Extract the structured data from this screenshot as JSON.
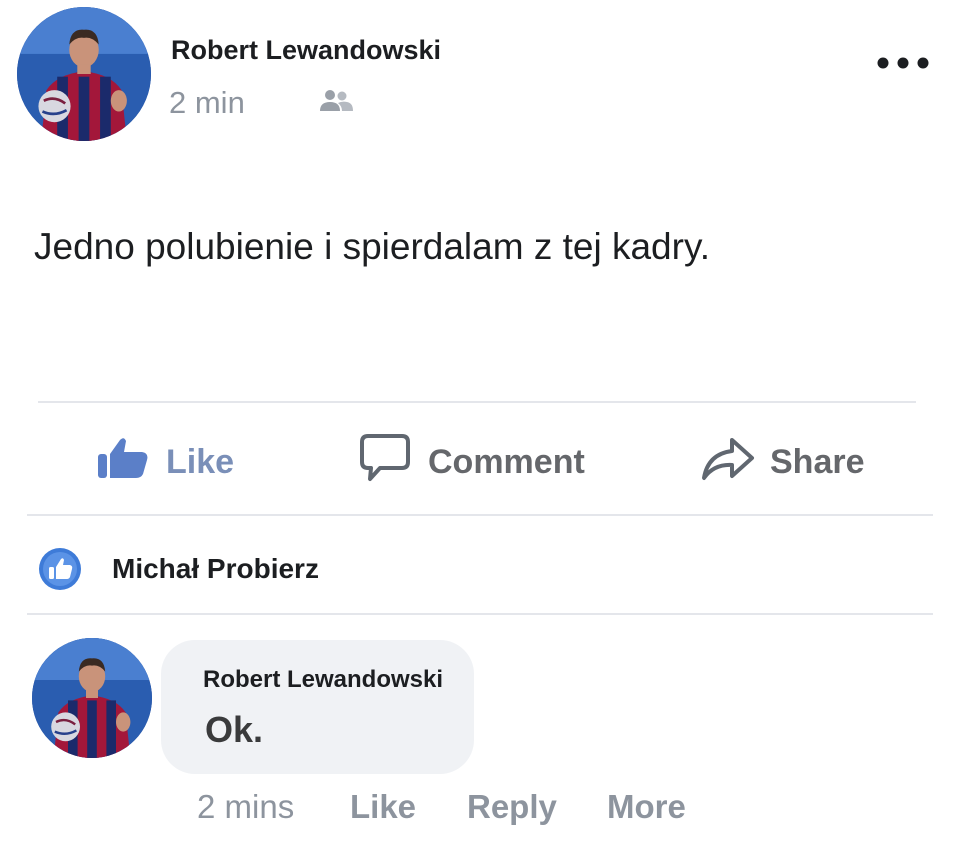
{
  "post": {
    "author": "Robert Lewandowski",
    "time": "2 min",
    "audience_icon": "friends-icon",
    "menu_icon": "more-dots-icon",
    "text": "Jedno polubienie i spierdalam z tej kadry."
  },
  "actions": {
    "like_label": "Like",
    "comment_label": "Comment",
    "share_label": "Share"
  },
  "reactions": {
    "icon": "like-badge-icon",
    "name": "Michał Probierz"
  },
  "comment": {
    "author": "Robert Lewandowski",
    "text": "Ok.",
    "time": "2 mins",
    "like_label": "Like",
    "reply_label": "Reply",
    "more_label": "More"
  },
  "colors": {
    "fb_blue": "#1877f2",
    "muted_text": "#8d949e",
    "bubble_bg": "#f0f2f5",
    "divider": "#e4e6eb"
  }
}
